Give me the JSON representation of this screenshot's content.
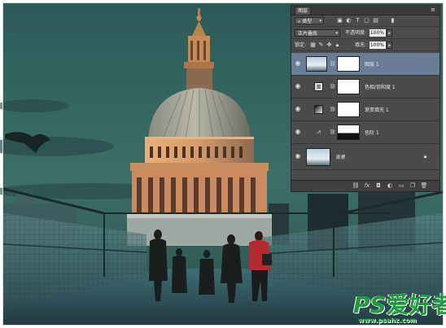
{
  "layers_panel": {
    "tab_label": "图层",
    "menu_icon": "panel-menu-icon",
    "filter": {
      "value": "类型"
    },
    "blend_mode": {
      "value": "正片叠底"
    },
    "opacity": {
      "label": "不透明度:",
      "value": "100%"
    },
    "lock": {
      "label": "锁定:"
    },
    "fill": {
      "label": "填充:",
      "value": "100%"
    },
    "layers": [
      {
        "name": "图层 1",
        "type": "pixel",
        "selected": true,
        "visible": true
      },
      {
        "name": "色相/饱和度 1",
        "type": "adjustment",
        "icon": "hue-saturation-icon",
        "visible": true
      },
      {
        "name": "渐变填充 1",
        "type": "adjustment",
        "icon": "gradient-fill-icon",
        "visible": true
      },
      {
        "name": "色阶 1",
        "type": "adjustment",
        "icon": "levels-icon",
        "visible": true
      },
      {
        "name": "背景",
        "type": "background",
        "visible": true
      }
    ],
    "footer_icons": [
      "link-icon",
      "fx-icon",
      "add-mask-icon",
      "new-adjustment-icon",
      "new-group-icon",
      "new-layer-icon",
      "trash-icon"
    ]
  },
  "watermark": {
    "brand": "PS",
    "brand_cn": "爱好者",
    "url": "www.psahz.com",
    "color": "#1f9a3c"
  },
  "colors": {
    "panel_bg": "#4b4b4b",
    "selected_layer": "#6a7d96",
    "sky": "#2f5c58"
  }
}
